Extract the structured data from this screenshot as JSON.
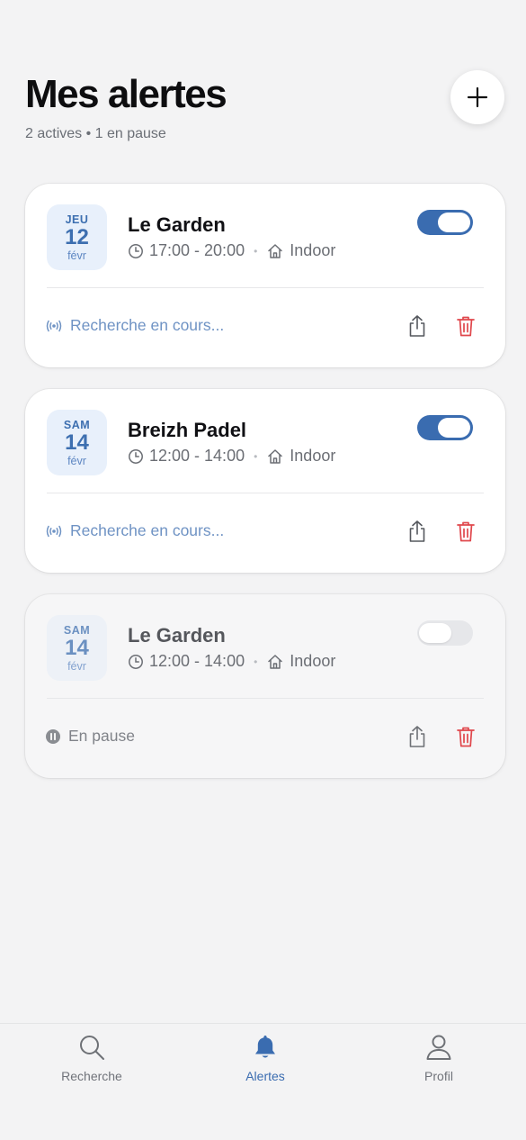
{
  "header": {
    "title": "Mes alertes",
    "subtitle": "2 actives • 1 en pause",
    "add_button_icon": "plus-icon"
  },
  "alerts": [
    {
      "day_of_week": "JEU",
      "day": "12",
      "month": "févr",
      "club": "Le Garden",
      "time": "17:00 - 20:00",
      "type": "Indoor",
      "enabled": true,
      "status": "Recherche en cours..."
    },
    {
      "day_of_week": "SAM",
      "day": "14",
      "month": "févr",
      "club": "Breizh Padel",
      "time": "12:00 - 14:00",
      "type": "Indoor",
      "enabled": true,
      "status": "Recherche en cours..."
    },
    {
      "day_of_week": "SAM",
      "day": "14",
      "month": "févr",
      "club": "Le Garden",
      "time": "12:00 - 14:00",
      "type": "Indoor",
      "enabled": false,
      "status": "En pause"
    }
  ],
  "tabs": [
    {
      "label": "Recherche",
      "icon": "search-icon",
      "active": false
    },
    {
      "label": "Alertes",
      "icon": "bell-icon",
      "active": true
    },
    {
      "label": "Profil",
      "icon": "user-icon",
      "active": false
    }
  ],
  "colors": {
    "accent": "#3a6cb0",
    "danger": "#e0474c",
    "background": "#f3f3f4"
  }
}
